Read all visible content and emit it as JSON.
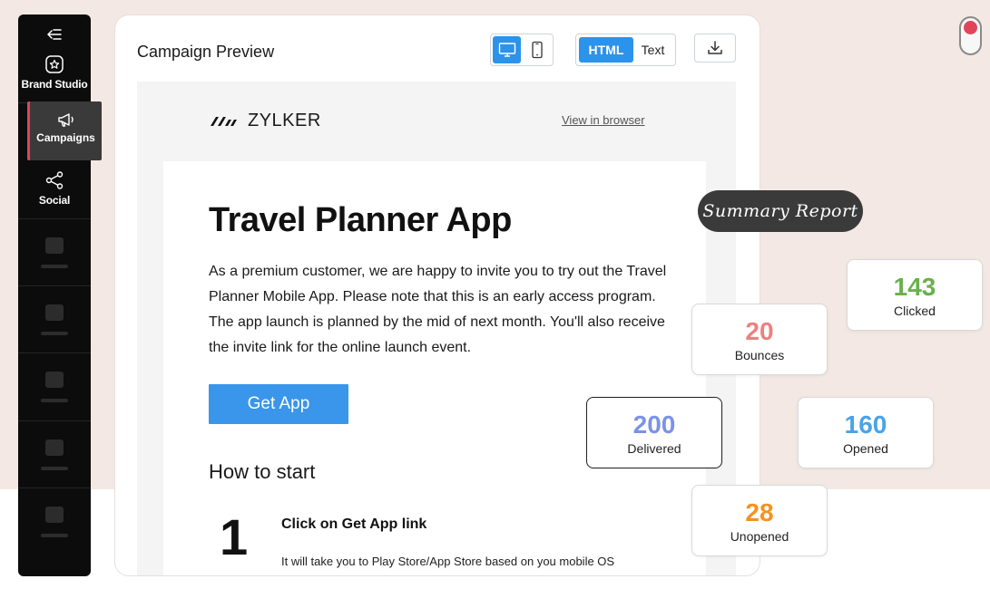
{
  "sidebar": {
    "items": [
      {
        "label": "Brand Studio",
        "icon": "brand-studio-icon"
      },
      {
        "label": "Campaigns",
        "icon": "megaphone-icon",
        "active": true
      },
      {
        "label": "Social",
        "icon": "share-icon"
      }
    ],
    "placeholder_count": 5,
    "active_color": "#e0455a"
  },
  "preview": {
    "title": "Campaign Preview",
    "device_toggle": {
      "selected": "desktop",
      "options": [
        "desktop",
        "mobile"
      ]
    },
    "format_toggle": {
      "html_label": "HTML",
      "text_label": "Text",
      "selected": "HTML"
    },
    "download_icon": "download-icon",
    "accent_color": "#2c93ea"
  },
  "email": {
    "brand": "ZYLKER",
    "view_in_browser": "View in browser",
    "heading": "Travel Planner App",
    "body": "As a premium customer, we are happy to invite you to try out the Travel Planner Mobile App. Please note that this is an early access program. The app launch is planned by the mid of next month. You'll also receive the invite link for the online launch event.",
    "cta": "Get App",
    "how_to_title": "How to start",
    "steps": [
      {
        "number": "1",
        "title": "Click on Get App link",
        "description": "It will take you to Play Store/App Store based on you mobile OS"
      }
    ]
  },
  "summary": {
    "label": "Summary Report",
    "stats": [
      {
        "value": "143",
        "label": "Clicked",
        "color": "#6ab04c"
      },
      {
        "value": "20",
        "label": "Bounces",
        "color": "#ef7f7f"
      },
      {
        "value": "200",
        "label": "Delivered",
        "color": "#7b93e6"
      },
      {
        "value": "160",
        "label": "Opened",
        "color": "#4aa3e8"
      },
      {
        "value": "28",
        "label": "Unopened",
        "color": "#f5921e"
      }
    ]
  },
  "record_toggle_color": "#e0455a"
}
